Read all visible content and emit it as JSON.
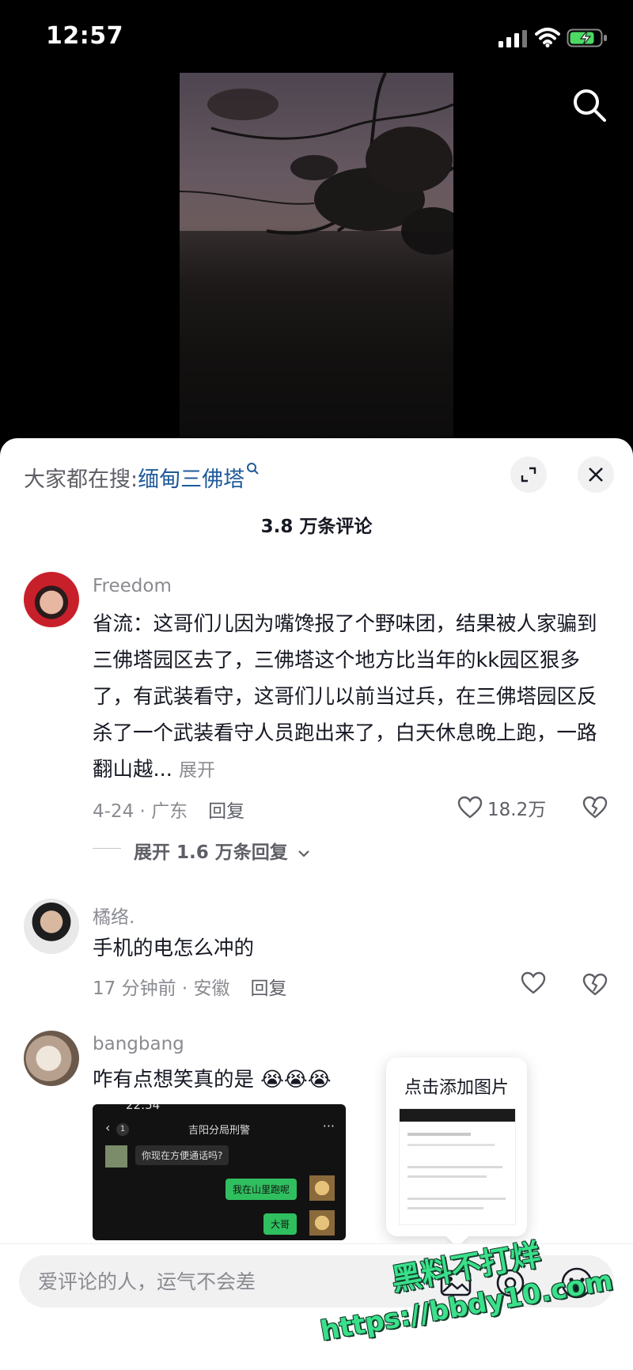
{
  "status_bar": {
    "time": "12:57"
  },
  "search_bar": {
    "prefix": "大家都在搜:",
    "keyword": "缅甸三佛塔"
  },
  "comments_header": {
    "count_label": "3.8 万条评论"
  },
  "comments": [
    {
      "username": "Freedom",
      "text": "省流：这哥们儿因为嘴馋报了个野味团，结果被人家骗到三佛塔园区去了，三佛塔这个地方比当年的kk园区狠多了，有武装看守，这哥们儿以前当过兵，在三佛塔园区反杀了一个武装看守人员跑出来了，白天休息晚上跑，一路翻山越...",
      "expand_label": "展开",
      "time_location": "4-24 · 广东",
      "reply_label": "回复",
      "likes": "18.2万",
      "expand_replies_label": "展开 1.6 万条回复"
    },
    {
      "username": "橘络.",
      "text": "手机的电怎么冲的",
      "time_location": "17 分钟前 · 安徽",
      "reply_label": "回复"
    },
    {
      "username": "bangbang",
      "text": "咋有点想笑真的是",
      "emojis": "😭😭😭",
      "image": {
        "time": "22:54",
        "title": "吉阳分局刑警",
        "back_count": "1",
        "messages": [
          {
            "text": "你现在方便通话吗?",
            "side": "left"
          },
          {
            "text": "我在山里跑呢",
            "side": "right"
          },
          {
            "text": "大哥",
            "side": "right"
          }
        ]
      }
    }
  ],
  "add_image_popup": {
    "label": "点击添加图片"
  },
  "input": {
    "placeholder": "爱评论的人，运气不会差"
  },
  "watermark": {
    "line1": "黑料不打烊",
    "line2": "https://bbdy10.com"
  },
  "colors": {
    "accent_link": "#1f5a9a",
    "muted_text": "#8a8b91",
    "chat_bubble_green": "#2fbf5e",
    "watermark_green": "#3ae08a"
  },
  "icons": [
    "search-icon",
    "expand-icon",
    "close-icon",
    "heart-icon",
    "broken-heart-icon",
    "chevron-down-icon",
    "image-icon",
    "at-icon",
    "emoji-icon"
  ]
}
